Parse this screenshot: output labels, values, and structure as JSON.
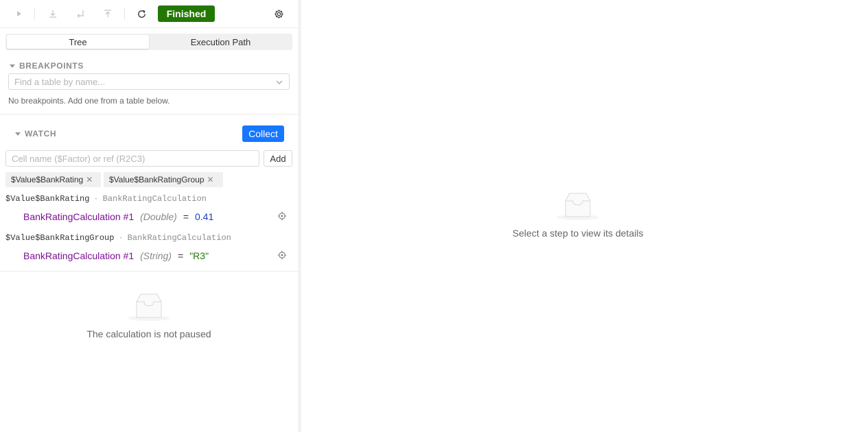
{
  "toolbar": {
    "status": "Finished",
    "icons": [
      "play-icon",
      "step-over-icon",
      "step-into-icon",
      "step-out-icon",
      "refresh-icon",
      "gear-icon"
    ]
  },
  "tabs": [
    {
      "label": "Tree",
      "active": true
    },
    {
      "label": "Execution Path",
      "active": false
    }
  ],
  "breakpoints": {
    "header": "BREAKPOINTS",
    "search_placeholder": "Find a table by name...",
    "empty_hint": "No breakpoints. Add one from a table below."
  },
  "watch": {
    "header": "WATCH",
    "collect_label": "Collect",
    "input_placeholder": "Cell name ($Factor) or ref (R2C3)",
    "add_label": "Add",
    "tags": [
      "$Value$BankRating",
      "$Value$BankRatingGroup"
    ],
    "items": [
      {
        "name": "$Value$BankRating",
        "table": "BankRatingCalculation",
        "ref": "BankRatingCalculation #1",
        "type": "(Double)",
        "eq": "=",
        "value": "0.41"
      },
      {
        "name": "$Value$BankRatingGroup",
        "table": "BankRatingCalculation",
        "ref": "BankRatingCalculation #1",
        "type": "(String)",
        "eq": "=",
        "value": "\"R3\""
      }
    ]
  },
  "not_paused_text": "The calculation is not paused",
  "details_empty_text": "Select a step to view its details",
  "colors": {
    "status_green": "#237804",
    "primary_blue": "#1677ff",
    "ref_purple": "#7b0f95",
    "number_blue": "#1d39c4",
    "string_green": "#237804"
  }
}
